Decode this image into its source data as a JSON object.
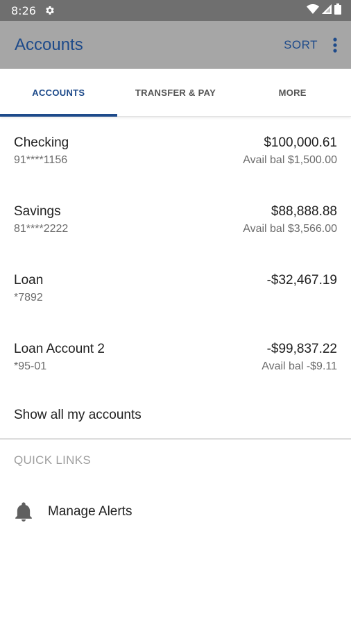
{
  "status_bar": {
    "time": "8:26"
  },
  "app_bar": {
    "title": "Accounts",
    "sort_label": "SORT"
  },
  "tabs": [
    {
      "label": "ACCOUNTS",
      "active": true
    },
    {
      "label": "TRANSFER & PAY",
      "active": false
    },
    {
      "label": "MORE",
      "active": false
    }
  ],
  "accounts": [
    {
      "name": "Checking",
      "number": "91****1156",
      "balance": "$100,000.61",
      "available": "Avail bal $1,500.00"
    },
    {
      "name": "Savings",
      "number": "81****2222",
      "balance": "$88,888.88",
      "available": "Avail bal $3,566.00"
    },
    {
      "name": "Loan",
      "number": "*7892",
      "balance": "-$32,467.19",
      "available": ""
    },
    {
      "name": "Loan Account 2",
      "number": "*95-01",
      "balance": "-$99,837.22",
      "available": "Avail bal -$9.11"
    }
  ],
  "show_all_label": "Show all my accounts",
  "quick_links": {
    "header": "QUICK LINKS",
    "items": [
      {
        "label": "Manage Alerts",
        "icon": "bell-icon"
      }
    ]
  },
  "colors": {
    "accent": "#1d4a8a",
    "app_bar_bg": "#a6a6a6",
    "status_bar_bg": "#6f6f6f"
  }
}
